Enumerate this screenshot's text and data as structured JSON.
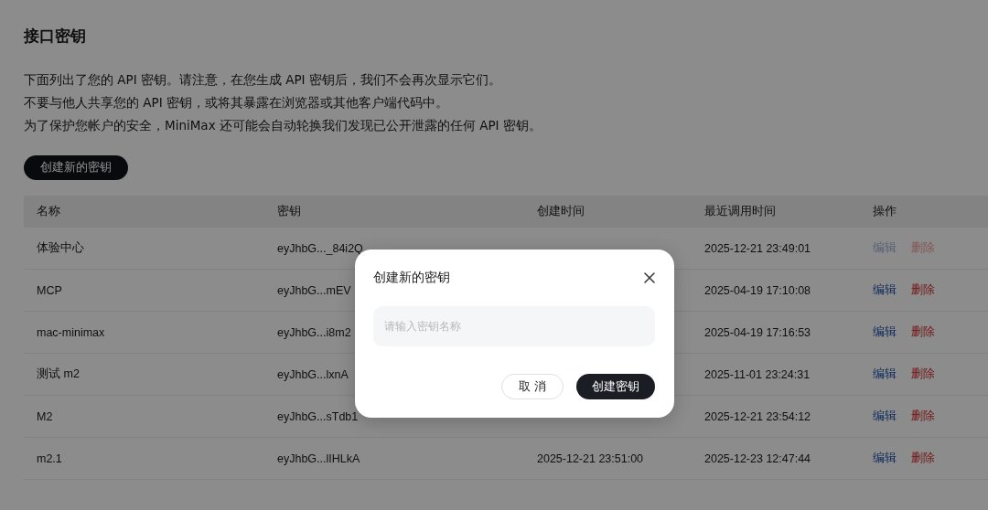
{
  "page": {
    "title": "接口密钥",
    "notes": [
      "下面列出了您的 API 密钥。请注意，在您生成 API 密钥后，我们不会再次显示它们。",
      "不要与他人共享您的 API 密钥，或将其暴露在浏览器或其他客户端代码中。",
      "为了保护您帐户的安全，MiniMax 还可能会自动轮换我们发现已公开泄露的任何 API 密钥。"
    ],
    "create_button": "创建新的密钥"
  },
  "table": {
    "columns": [
      "名称",
      "密钥",
      "创建时间",
      "最近调用时间",
      "操作"
    ],
    "rows": [
      {
        "name": "体验中心",
        "key": "eyJhbG..._84i2Q",
        "last_used": "2025-12-21 23:49:01",
        "edit": "编辑",
        "delete": "删除",
        "disabled": true
      },
      {
        "name": "MCP",
        "key": "eyJhbG...mEV",
        "last_used": "2025-04-19 17:10:08",
        "edit": "编辑",
        "delete": "删除",
        "disabled": false
      },
      {
        "name": "mac-minimax",
        "key": "eyJhbG...i8m2",
        "last_used": "2025-04-19 17:16:53",
        "edit": "编辑",
        "delete": "删除",
        "disabled": false
      },
      {
        "name": "测试 m2",
        "key": "eyJhbG...lxnA",
        "last_used": "2025-11-01 23:24:31",
        "edit": "编辑",
        "delete": "删除",
        "disabled": false
      },
      {
        "name": "M2",
        "key": "eyJhbG...sTdb1",
        "last_used": "2025-12-21 23:54:12",
        "edit": "编辑",
        "delete": "删除",
        "disabled": false
      },
      {
        "name": "m2.1",
        "key": "eyJhbG...lIHLkA",
        "created": "2025-12-21 23:51:00",
        "last_used": "2025-12-23 12:47:44",
        "edit": "编辑",
        "delete": "删除",
        "disabled": false
      }
    ]
  },
  "dialog": {
    "title": "创建新的密钥",
    "placeholder": "请输入密钥名称",
    "cancel": "取 消",
    "confirm": "创建密钥"
  }
}
